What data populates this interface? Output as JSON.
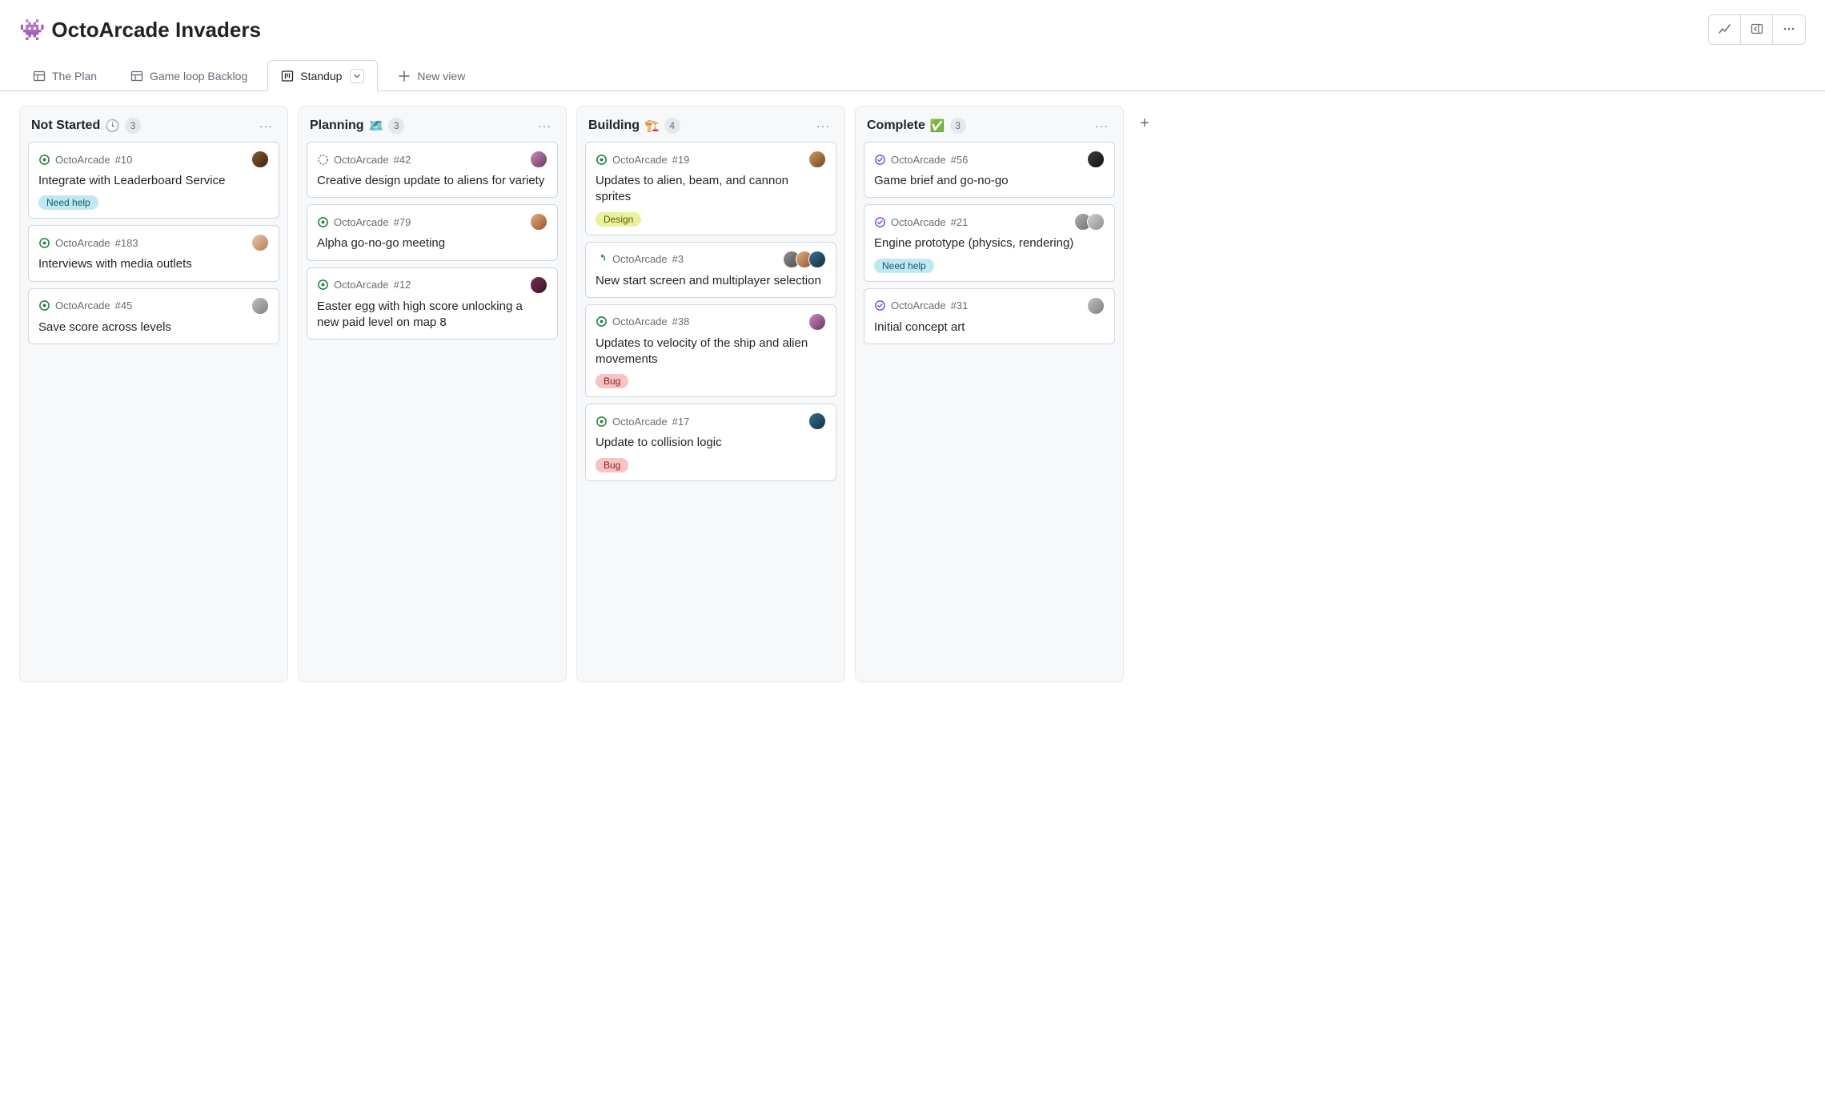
{
  "project": {
    "emoji": "👾",
    "title": "OctoArcade Invaders"
  },
  "tabs": [
    {
      "label": "The Plan",
      "icon": "table",
      "active": false
    },
    {
      "label": "Game loop Backlog",
      "icon": "table",
      "active": false
    },
    {
      "label": "Standup",
      "icon": "board",
      "active": true
    },
    {
      "label": "New view",
      "icon": "plus",
      "active": false,
      "is_new": true
    }
  ],
  "columns": [
    {
      "title": "Not Started",
      "emoji": "🕓",
      "count": "3",
      "cards": [
        {
          "status": "open",
          "repo": "OctoArcade",
          "ref": "#10",
          "title": "Integrate with Leaderboard Service",
          "avatars": [
            "av1"
          ],
          "labels": [
            {
              "text": "Need help",
              "cls": "lbl-needhelp"
            }
          ]
        },
        {
          "status": "open",
          "repo": "OctoArcade",
          "ref": "#183",
          "title": "Interviews with media outlets",
          "avatars": [
            "av2"
          ],
          "labels": []
        },
        {
          "status": "open",
          "repo": "OctoArcade",
          "ref": "#45",
          "title": "Save score across levels",
          "avatars": [
            "av3"
          ],
          "labels": []
        }
      ]
    },
    {
      "title": "Planning",
      "emoji": "🗺️",
      "count": "3",
      "cards": [
        {
          "status": "draft",
          "repo": "OctoArcade",
          "ref": "#42",
          "title": "Creative design update to aliens for variety",
          "avatars": [
            "av4"
          ],
          "labels": []
        },
        {
          "status": "open",
          "repo": "OctoArcade",
          "ref": "#79",
          "title": "Alpha go-no-go meeting",
          "avatars": [
            "av5"
          ],
          "labels": []
        },
        {
          "status": "open",
          "repo": "OctoArcade",
          "ref": "#12",
          "title": "Easter egg with high score unlocking a new paid level on map 8",
          "avatars": [
            "av6"
          ],
          "labels": []
        }
      ]
    },
    {
      "title": "Building",
      "emoji": "🏗️",
      "count": "4",
      "cards": [
        {
          "status": "open",
          "repo": "OctoArcade",
          "ref": "#19",
          "title": "Updates to alien, beam, and cannon sprites",
          "avatars": [
            "av7"
          ],
          "labels": [
            {
              "text": "Design",
              "cls": "lbl-design"
            }
          ]
        },
        {
          "status": "pr",
          "repo": "OctoArcade",
          "ref": "#3",
          "title": "New start screen and multiplayer selection",
          "avatars": [
            "av8",
            "av5",
            "av9"
          ],
          "labels": []
        },
        {
          "status": "open",
          "repo": "OctoArcade",
          "ref": "#38",
          "title": "Updates to velocity of the ship and alien movements",
          "avatars": [
            "av4"
          ],
          "labels": [
            {
              "text": "Bug",
              "cls": "lbl-bug"
            }
          ]
        },
        {
          "status": "open",
          "repo": "OctoArcade",
          "ref": "#17",
          "title": "Update to collision logic",
          "avatars": [
            "av9"
          ],
          "labels": [
            {
              "text": "Bug",
              "cls": "lbl-bug"
            }
          ]
        }
      ]
    },
    {
      "title": "Complete",
      "emoji": "✅",
      "count": "3",
      "cards": [
        {
          "status": "closed",
          "repo": "OctoArcade",
          "ref": "#56",
          "title": "Game brief and go-no-go",
          "avatars": [
            "av10"
          ],
          "labels": []
        },
        {
          "status": "closed",
          "repo": "OctoArcade",
          "ref": "#21",
          "title": "Engine prototype (physics, rendering)",
          "avatars": [
            "av11",
            "av12"
          ],
          "labels": [
            {
              "text": "Need help",
              "cls": "lbl-needhelp"
            }
          ]
        },
        {
          "status": "closed",
          "repo": "OctoArcade",
          "ref": "#31",
          "title": "Initial concept art",
          "avatars": [
            "av3"
          ],
          "labels": []
        }
      ]
    }
  ]
}
